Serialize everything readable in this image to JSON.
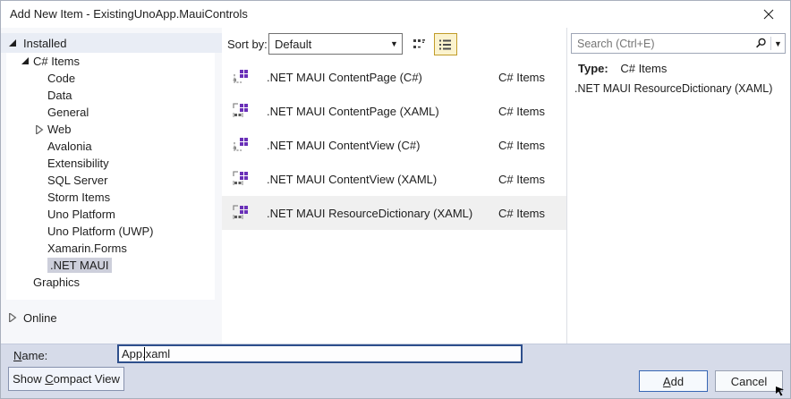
{
  "window": {
    "title": "Add New Item - ExistingUnoApp.MauiControls"
  },
  "colors": {
    "accent_navy": "#2E4F8C",
    "add_button_border": "#3766B4",
    "tree_selection_gray": "#CDCFDB",
    "list_row_selected": "#F0F0F0",
    "view_button_selected_bg": "#FBF3CE",
    "view_button_selected_border": "#C19C29",
    "template_icon_purple": "#6A30B8",
    "footer_bg": "#D6DBE9",
    "installed_header_bg": "#E9EDF5"
  },
  "left_panel": {
    "installed_label": "Installed",
    "online_label": "Online",
    "tree": {
      "items": [
        {
          "label": "C# Items"
        },
        {
          "label": "Code"
        },
        {
          "label": "Data"
        },
        {
          "label": "General"
        },
        {
          "label": "Web"
        },
        {
          "label": "Avalonia"
        },
        {
          "label": "Extensibility"
        },
        {
          "label": "SQL Server"
        },
        {
          "label": "Storm Items"
        },
        {
          "label": "Uno Platform"
        },
        {
          "label": "Uno Platform (UWP)"
        },
        {
          "label": "Xamarin.Forms"
        },
        {
          "label": ".NET MAUI"
        },
        {
          "label": "Graphics"
        }
      ]
    }
  },
  "toolbar": {
    "sort_label": "Sort by:",
    "sort_value": "Default"
  },
  "templates": {
    "items": [
      {
        "name": ".NET MAUI ContentPage (C#)",
        "type": "C# Items"
      },
      {
        "name": ".NET MAUI ContentPage (XAML)",
        "type": "C# Items"
      },
      {
        "name": ".NET MAUI ContentView (C#)",
        "type": "C# Items"
      },
      {
        "name": ".NET MAUI ContentView (XAML)",
        "type": "C# Items"
      },
      {
        "name": ".NET MAUI ResourceDictionary (XAML)",
        "type": "C# Items"
      }
    ]
  },
  "right_panel": {
    "search_placeholder": "Search (Ctrl+E)",
    "type_label": "Type:",
    "type_value": "C# Items",
    "description": ".NET MAUI ResourceDictionary (XAML)"
  },
  "footer": {
    "name_label_u": "N",
    "name_label_rest": "ame:",
    "name_value": "App.xaml",
    "compact_pre": "Show ",
    "compact_u": "C",
    "compact_rest": "ompact View",
    "add_u": "A",
    "add_rest": "dd",
    "cancel_label": "Cancel"
  }
}
